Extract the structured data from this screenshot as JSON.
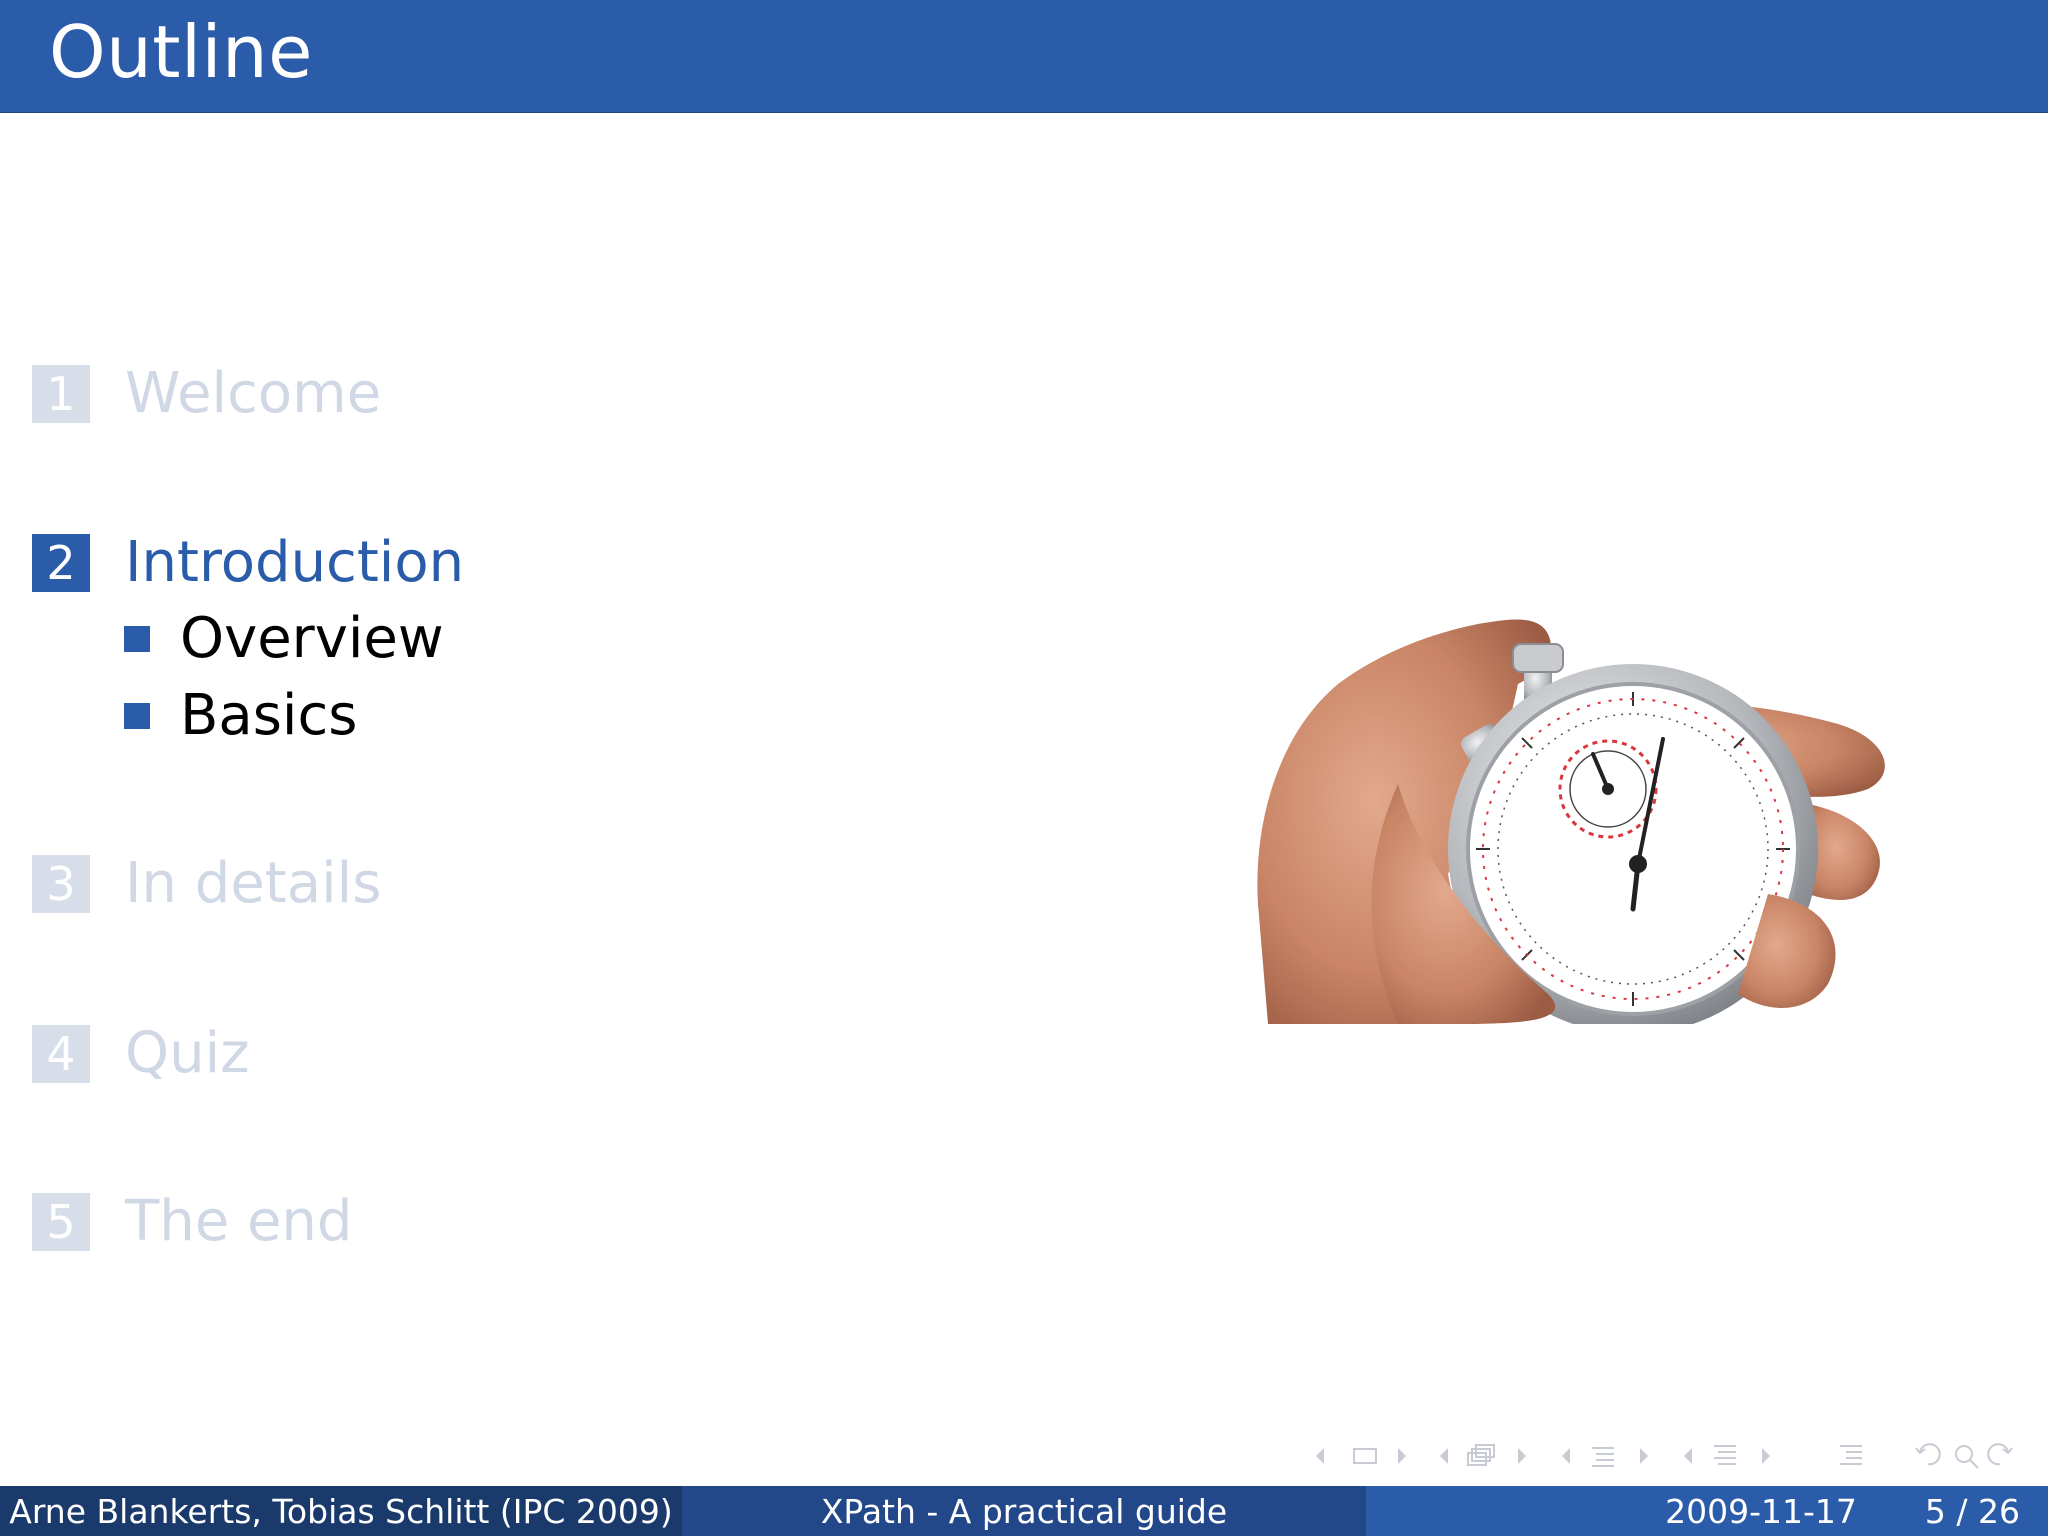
{
  "header": {
    "title": "Outline"
  },
  "toc": {
    "sections": [
      {
        "number": "1",
        "label": "Welcome"
      },
      {
        "number": "2",
        "label": "Introduction"
      },
      {
        "number": "3",
        "label": "In details"
      },
      {
        "number": "4",
        "label": "Quiz"
      },
      {
        "number": "5",
        "label": "The end"
      }
    ],
    "subsections": [
      "Overview",
      "Basics"
    ],
    "current_section": "2"
  },
  "illustration": {
    "icon": "stopwatch-in-hand-icon"
  },
  "navigation": {
    "icons": [
      "nav-frame-prev-icon",
      "nav-frame-icon",
      "nav-frame-next-icon",
      "nav-slide-prev-icon",
      "nav-slide-icon",
      "nav-slide-next-icon",
      "nav-subsection-prev-icon",
      "nav-subsection-icon",
      "nav-subsection-next-icon",
      "nav-section-prev-icon",
      "nav-section-icon",
      "nav-section-next-icon",
      "nav-toc-icon",
      "nav-back-icon",
      "nav-search-icon",
      "nav-forward-icon"
    ]
  },
  "footer": {
    "authors": "Arne Blankerts, Tobias Schlitt  (IPC 2009)",
    "title": "XPath - A practical guide",
    "date": "2009-11-17",
    "page": "5 / 26"
  },
  "colors": {
    "primary": "#2b5ca9",
    "footer_dark": "#1a3a6c",
    "footer_mid": "#22488a",
    "dimmed": "#d0d8e6"
  }
}
